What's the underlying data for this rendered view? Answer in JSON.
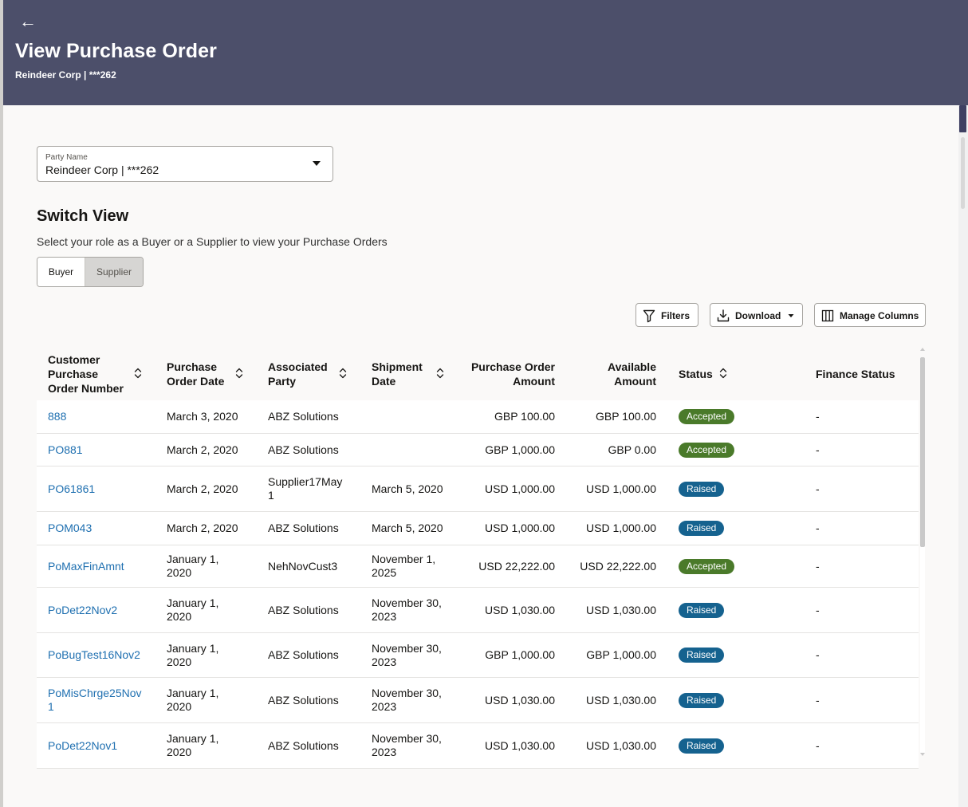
{
  "header": {
    "title": "View Purchase Order",
    "subtitle": "Reindeer Corp | ***262"
  },
  "party": {
    "label": "Party Name",
    "value": "Reindeer Corp | ***262"
  },
  "switch_view": {
    "title": "Switch View",
    "description": "Select your role as a Buyer or a Supplier to view your Purchase Orders",
    "options": [
      "Buyer",
      "Supplier"
    ],
    "selected": "Supplier"
  },
  "toolbar": {
    "filters_label": "Filters",
    "download_label": "Download",
    "manage_columns_label": "Manage Columns"
  },
  "table": {
    "columns": {
      "po_number": [
        "Customer",
        "Purchase",
        "Order Number"
      ],
      "po_date": [
        "Purchase",
        "Order Date"
      ],
      "party": [
        "Associated",
        "Party"
      ],
      "shipment": [
        "Shipment",
        "Date"
      ],
      "po_amount": [
        "Purchase Order",
        "Amount"
      ],
      "available": [
        "Available",
        "Amount"
      ],
      "status": "Status",
      "finance": "Finance Status"
    },
    "rows": [
      {
        "po": [
          "888"
        ],
        "date": [
          "March 3, 2020"
        ],
        "party": [
          "ABZ Solutions"
        ],
        "ship": [],
        "amount": "GBP 100.00",
        "available": "GBP 100.00",
        "status": "Accepted",
        "finance": "-"
      },
      {
        "po": [
          "PO881"
        ],
        "date": [
          "March 2, 2020"
        ],
        "party": [
          "ABZ Solutions"
        ],
        "ship": [],
        "amount": "GBP 1,000.00",
        "available": "GBP 0.00",
        "status": "Accepted",
        "finance": "-"
      },
      {
        "po": [
          "PO61861"
        ],
        "date": [
          "March 2, 2020"
        ],
        "party": [
          "Supplier17May",
          "1"
        ],
        "ship": [
          "March 5, 2020"
        ],
        "amount": "USD 1,000.00",
        "available": "USD 1,000.00",
        "status": "Raised",
        "finance": "-"
      },
      {
        "po": [
          "POM043"
        ],
        "date": [
          "March 2, 2020"
        ],
        "party": [
          "ABZ Solutions"
        ],
        "ship": [
          "March 5, 2020"
        ],
        "amount": "USD 1,000.00",
        "available": "USD 1,000.00",
        "status": "Raised",
        "finance": "-"
      },
      {
        "po": [
          "PoMaxFinAmnt"
        ],
        "date": [
          "January 1,",
          "2020"
        ],
        "party": [
          "NehNovCust3"
        ],
        "ship": [
          "November 1,",
          "2025"
        ],
        "amount": "USD 22,222.00",
        "available": "USD 22,222.00",
        "status": "Accepted",
        "finance": "-"
      },
      {
        "po": [
          "PoDet22Nov2"
        ],
        "date": [
          "January 1,",
          "2020"
        ],
        "party": [
          "ABZ Solutions"
        ],
        "ship": [
          "November 30,",
          "2023"
        ],
        "amount": "USD 1,030.00",
        "available": "USD 1,030.00",
        "status": "Raised",
        "finance": "-"
      },
      {
        "po": [
          "PoBugTest16Nov2"
        ],
        "date": [
          "January 1,",
          "2020"
        ],
        "party": [
          "ABZ Solutions"
        ],
        "ship": [
          "November 30,",
          "2023"
        ],
        "amount": "GBP 1,000.00",
        "available": "GBP 1,000.00",
        "status": "Raised",
        "finance": "-"
      },
      {
        "po": [
          "PoMisChrge25Nov",
          "1"
        ],
        "date": [
          "January 1,",
          "2020"
        ],
        "party": [
          "ABZ Solutions"
        ],
        "ship": [
          "November 30,",
          "2023"
        ],
        "amount": "USD 1,030.00",
        "available": "USD 1,030.00",
        "status": "Raised",
        "finance": "-"
      },
      {
        "po": [
          "PoDet22Nov1"
        ],
        "date": [
          "January 1,",
          "2020"
        ],
        "party": [
          "ABZ Solutions"
        ],
        "ship": [
          "November 30,",
          "2023"
        ],
        "amount": "USD 1,030.00",
        "available": "USD 1,030.00",
        "status": "Raised",
        "finance": "-"
      }
    ]
  },
  "colors": {
    "header_bg": "#4c4f6a",
    "link": "#1e6fb0",
    "accepted": "#4a7a2a",
    "raised": "#15628f"
  }
}
